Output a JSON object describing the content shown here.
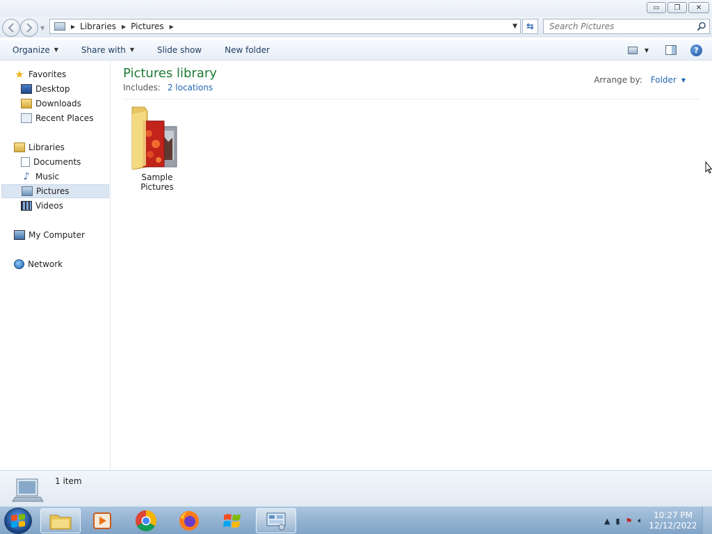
{
  "window": {
    "minimize_glyph": "▭",
    "maximize_glyph": "❐",
    "close_glyph": "✕"
  },
  "navbar": {
    "breadcrumbs": [
      "Libraries",
      "Pictures"
    ],
    "search_placeholder": "Search Pictures"
  },
  "toolbar": {
    "organize": "Organize",
    "share_with": "Share with",
    "slide_show": "Slide show",
    "new_folder": "New folder"
  },
  "sidebar": {
    "favorites": {
      "label": "Favorites",
      "items": [
        "Desktop",
        "Downloads",
        "Recent Places"
      ]
    },
    "libraries": {
      "label": "Libraries",
      "items": [
        "Documents",
        "Music",
        "Pictures",
        "Videos"
      ]
    },
    "computer": "My Computer",
    "network": "Network"
  },
  "main": {
    "title": "Pictures library",
    "includes_label": "Includes:",
    "includes_link": "2 locations",
    "arrange_label": "Arrange by:",
    "arrange_value": "Folder",
    "items": [
      {
        "name": "Sample Pictures",
        "type": "folder"
      }
    ]
  },
  "status": {
    "item_count": "1 item"
  },
  "taskbar": {
    "time": "10:27 PM",
    "date": "12/12/2022",
    "apps": [
      "windows-explorer",
      "media-player",
      "chrome",
      "firefox",
      "windows-logo",
      "control-panel"
    ]
  },
  "colors": {
    "title_green": "#1e7a36",
    "link_blue": "#2267b3",
    "taskbar": "#8fb0d0"
  }
}
